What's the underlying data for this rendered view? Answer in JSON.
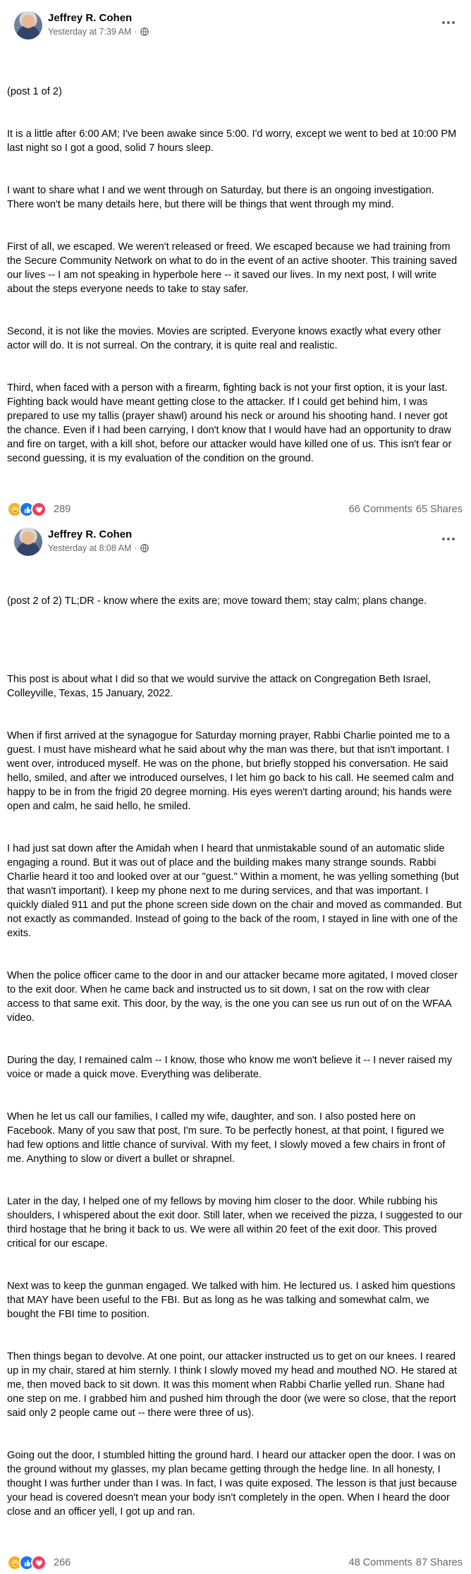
{
  "posts": [
    {
      "author": "Jeffrey R. Cohen",
      "timestamp": "Yesterday at 7:39 AM",
      "separator": "·",
      "paragraphs": [
        "(post 1 of 2)",
        "It is a little after 6:00 AM; I've been awake since 5:00. I'd worry, except we went to bed at 10:00 PM last night so I got a good, solid 7 hours sleep.",
        "I want to share what I and we went through on Saturday, but there is an ongoing investigation. There won't be many details here, but there will be things that went through my mind.",
        "First of all, we escaped. We weren't released or freed. We escaped because we had training from the Secure Community Network on what to do in the event of an active shooter. This training saved our lives -- I am not speaking in hyperbole here -- it saved our lives. In my next post, I will write about the steps everyone needs to take to stay safer.",
        "Second, it is not like the movies. Movies are scripted. Everyone knows exactly what every other actor will do. It is not surreal. On the contrary, it is quite real and realistic.",
        "Third, when faced with a person with a firearm, fighting back is not your first option, it is your last. Fighting back would have meant getting close to the attacker. If I could get behind him, I was prepared to use my tallis (prayer shawl) around his neck or around his shooting hand. I never got the chance. Even if I had been carrying, I don't know that I would have had an opportunity to draw and fire on target, with a kill shot, before our attacker would have killed one of us. This isn't fear or second guessing, it is my evaluation of the condition on the ground."
      ],
      "reaction_count": "289",
      "comments": "66 Comments",
      "shares": "65 Shares"
    },
    {
      "author": "Jeffrey R. Cohen",
      "timestamp": "Yesterday at 8:08 AM",
      "separator": "·",
      "paragraphs": [
        "(post 2 of 2) TL;DR - know where the exits are; move toward them; stay calm; plans change.",
        "",
        "This post is about what I did so that we would survive the attack on Congregation Beth Israel, Colleyville, Texas, 15 January, 2022.",
        "When if first arrived at the synagogue for Saturday morning prayer, Rabbi Charlie pointed me to a guest. I must have misheard what he said about why the man was there, but that isn't important. I went over, introduced myself. He was on the phone, but briefly stopped his conversation. He said hello, smiled, and after we introduced ourselves, I let him go back to his call. He seemed calm and happy to be in from the frigid 20 degree morning. His eyes weren't darting around; his hands were open and calm, he said hello, he smiled.",
        "I had just sat down after the Amidah when I heard that unmistakable sound of an automatic slide engaging a round. But it was out of place and the building makes many strange sounds. Rabbi Charlie heard it too and looked over at our \"guest.\" Within a moment, he was yelling something (but that wasn't important). I keep my phone next to me during services, and that was important. I quickly dialed 911 and put the phone screen side down on the chair and moved as commanded. But not exactly as commanded. Instead of going to the back of the room, I stayed in line with one of the exits.",
        "When the police officer came to the door in and our attacker became more agitated, I moved closer to the exit door. When he came back and instructed us to sit down, I sat on the row with clear access to that same exit. This door, by the way, is the one you can see us run out of on the WFAA video.",
        "During the day, I remained calm -- I know, those who know me won't believe it -- I never raised my voice or made a quick move. Everything was deliberate.",
        "When he let us call our families, I called my wife, daughter, and son. I also posted here on Facebook. Many of you saw that post, I'm sure. To be perfectly honest, at that point, I figured we had few options and little chance of survival. With my feet, I slowly moved a few chairs in front of me. Anything to slow or divert a bullet or shrapnel.",
        "Later in the day, I helped one of my fellows by moving him closer to the door. While rubbing his shoulders, I whispered about the exit door. Still later, when we received the pizza, I suggested to our third hostage that he bring it back to us. We were all within 20 feet of the exit door. This proved critical for our escape.",
        "Next was to keep the gunman engaged. We talked with him. He lectured us. I asked him questions that MAY have been useful to the FBI. But as long as he was talking and somewhat calm, we bought the FBI time to position.",
        "Then things began to devolve. At one point, our attacker instructed us to get on our knees. I reared up in my chair, stared at him sternly. I think I slowly moved my head and mouthed NO. He stared at me, then moved back to sit down. It was this moment when Rabbi Charlie yelled run. Shane had one step on me. I grabbed him and pushed him through the door (we were so close, that the report said only 2 people came out -- there were three of us).",
        "Going out the door, I stumbled hitting the ground hard. I heard our attacker open the door. I was on the ground without my glasses, my plan became getting through the hedge line. In all honesty, I thought I was further under than I was. In fact, I was quite exposed. The lesson is that just because your head is covered doesn't mean your body isn't completely in the open. When I heard the door close and an officer yell, I got up and ran."
      ],
      "reaction_count": "266",
      "comments": "48 Comments",
      "shares": "87 Shares"
    }
  ],
  "colors": {
    "like": "#1877f2",
    "love": "#f33e58",
    "care": "#f7b125",
    "secondary_text": "#65676b"
  },
  "icons": {
    "globe": "globe-icon",
    "more": "more-options-icon",
    "like": "like-icon",
    "love": "heart-icon",
    "care": "care-icon"
  }
}
